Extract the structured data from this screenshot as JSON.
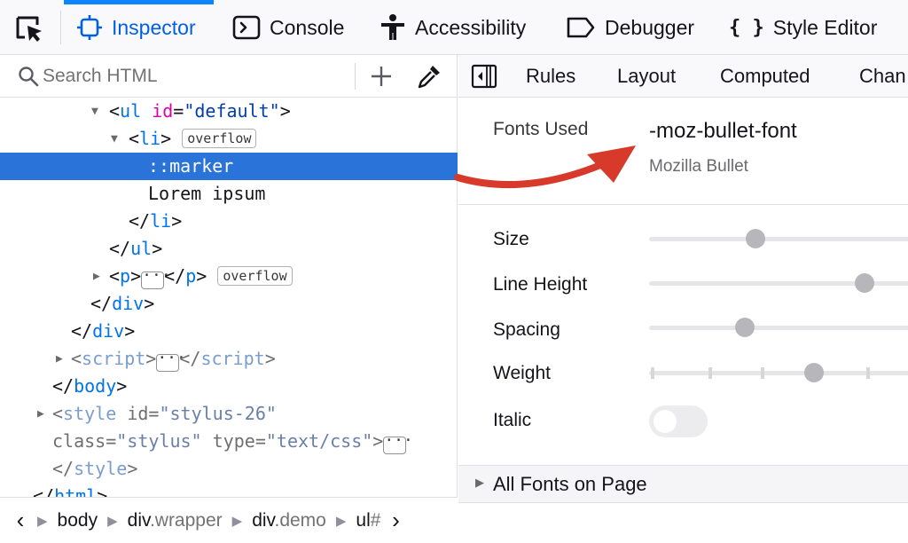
{
  "toolbar": {
    "tabs": [
      {
        "label": "Inspector",
        "icon": "inspector-icon",
        "selected": true
      },
      {
        "label": "Console",
        "icon": "console-icon"
      },
      {
        "label": "Accessibility",
        "icon": "accessibility-icon"
      },
      {
        "label": "Debugger",
        "icon": "debugger-icon"
      },
      {
        "label": "Style Editor",
        "icon": "style-editor-icon",
        "glyph": "{ }"
      }
    ]
  },
  "search": {
    "placeholder": "Search HTML",
    "value": ""
  },
  "markup": {
    "ul_tag": "ul",
    "ul_attr": "id",
    "ul_val": "\"default\"",
    "li_tag": "li",
    "overflow_badge": "overflow",
    "marker": "::marker",
    "text_node": "Lorem ipsum",
    "li_close": "li",
    "ul_close": "ul",
    "p_tag": "p",
    "p_close": "p",
    "p_badge": "overflow",
    "div1_close": "div",
    "div2_close": "div",
    "script_tag": "script",
    "script_close": "script",
    "body_close": "body",
    "style_tag": "style",
    "style_id_attr": "id",
    "style_id_val": "\"stylus-26\"",
    "style_class_attr": "class",
    "style_class_val": "\"stylus\"",
    "style_type_attr": "type",
    "style_type_val": "\"text/css\"",
    "style_close": "style",
    "html_close": "html"
  },
  "breadcrumbs": [
    {
      "tag": "body",
      "cls": ""
    },
    {
      "tag": "div",
      "cls": ".wrapper"
    },
    {
      "tag": "div",
      "cls": ".demo"
    },
    {
      "tag": "ul",
      "cls": "#"
    }
  ],
  "right_tabs": [
    "Rules",
    "Layout",
    "Computed",
    "Chan"
  ],
  "fonts": {
    "used_label": "Fonts Used",
    "font_name": "-moz-bullet-font",
    "font_family": "Mozilla Bullet"
  },
  "properties": {
    "size": {
      "label": "Size",
      "level": 0.4
    },
    "line_height": {
      "label": "Line Height",
      "level": 0.81
    },
    "spacing": {
      "label": "Spacing",
      "level": 0.36
    },
    "weight": {
      "label": "Weight",
      "level": 0.62
    },
    "italic": {
      "label": "Italic",
      "on": false
    }
  },
  "all_fonts_label": "All Fonts on Page",
  "colors": {
    "accent": "#0a84ff",
    "selection": "#2a73d8",
    "arrow": "#d73a2a"
  }
}
